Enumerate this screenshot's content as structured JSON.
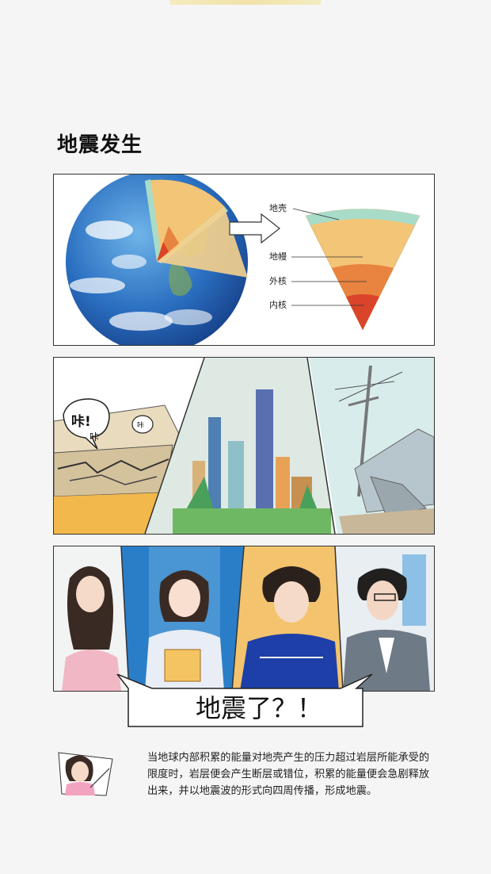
{
  "page": {
    "title": "地震发生"
  },
  "earth_diagram": {
    "layers": [
      "地壳",
      "地幔",
      "外核",
      "内核"
    ],
    "colors": {
      "crust": "#a8dcc8",
      "mantle": "#f3c577",
      "outer_core": "#e8843f",
      "inner_core": "#d9442a"
    }
  },
  "scene_panel": {
    "sound_large": "咔!",
    "sound_medium": "咔",
    "sound_small": "咔"
  },
  "people_panel": {
    "exclamation": "地震了？！"
  },
  "explanation": {
    "text": "当地球内部积累的能量对地壳产生的压力超过岩层所能承受的限度时，岩层便会产生断层或错位，积累的能量便会急剧释放出来，并以地震波的形式向四周传播，形成地震。"
  }
}
